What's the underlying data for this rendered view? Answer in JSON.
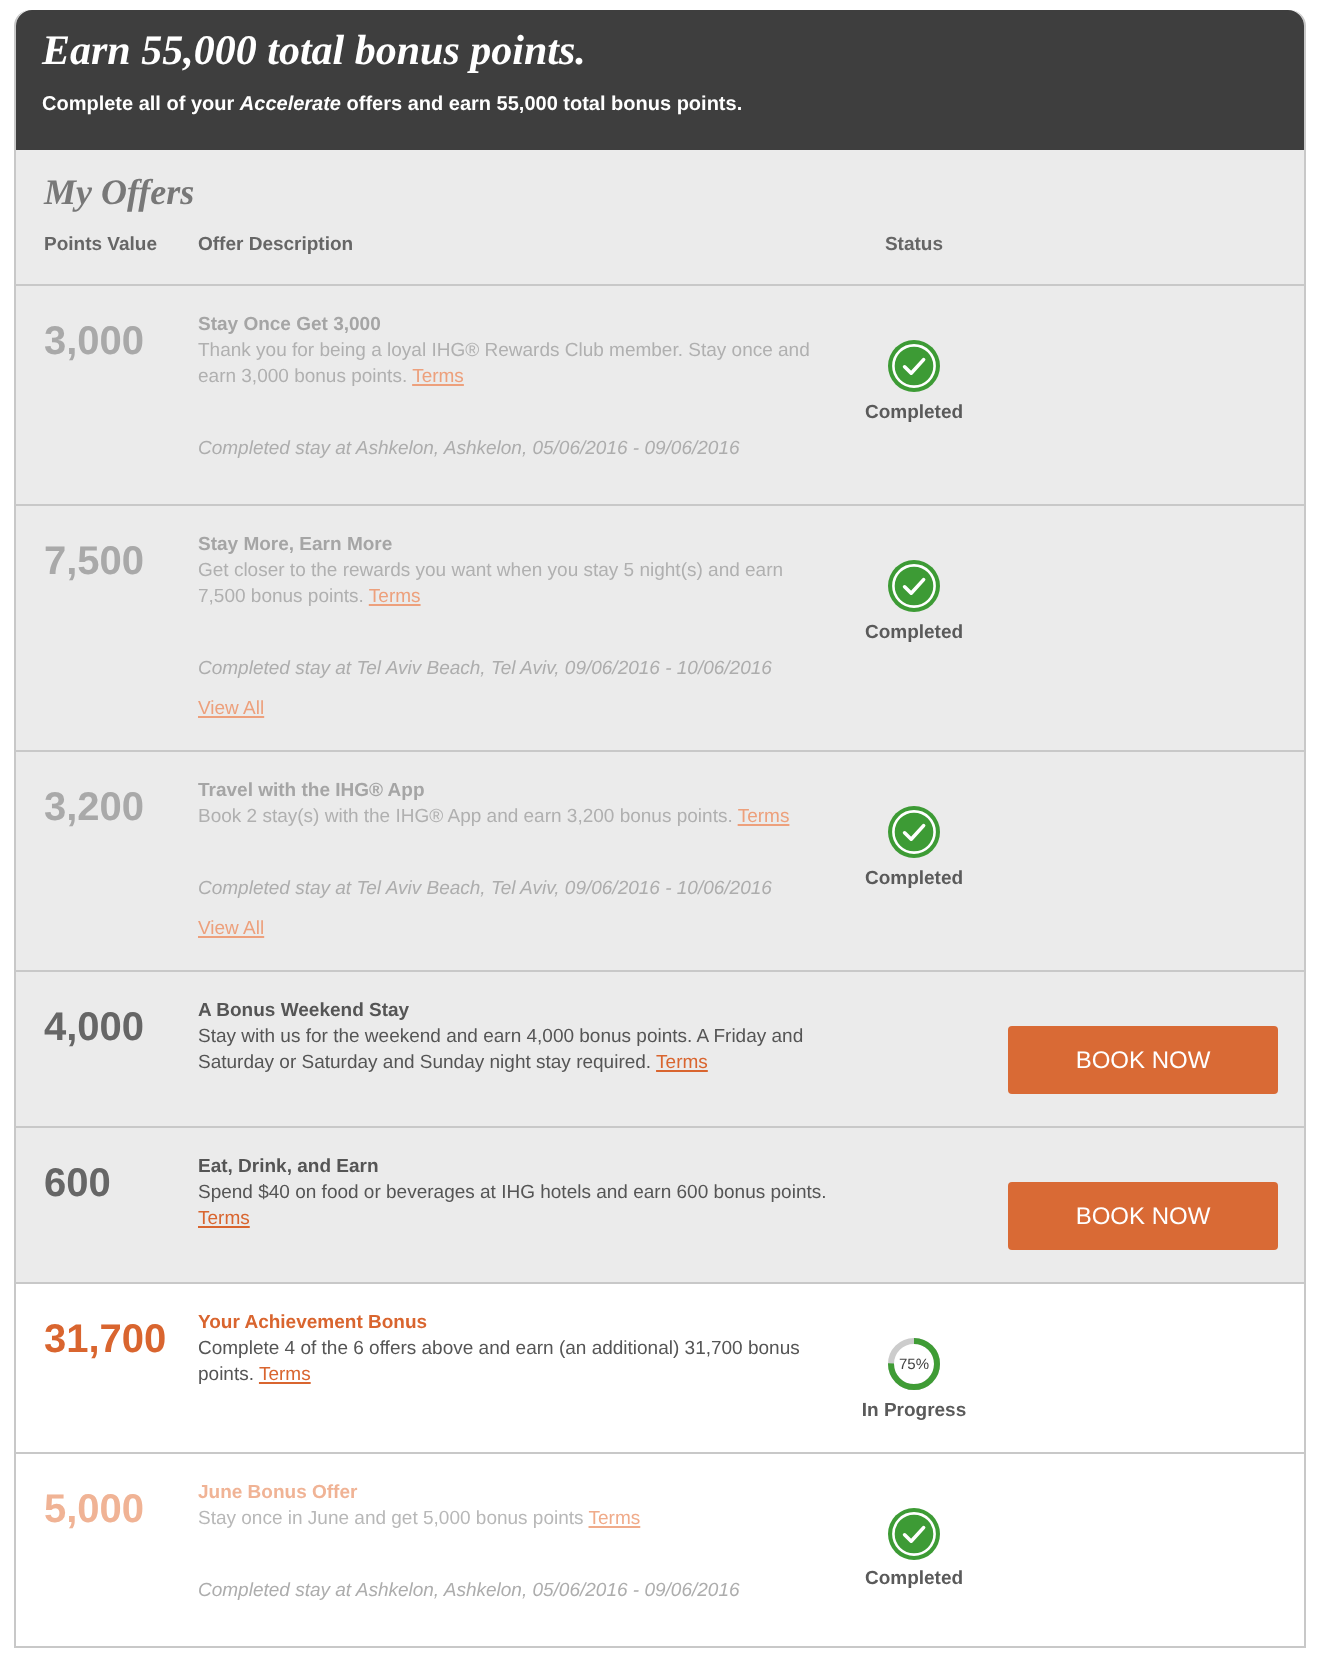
{
  "header": {
    "title": "Earn 55,000 total bonus points.",
    "subtitle": "Complete all of your *Accelerate* offers and earn 55,000 total bonus points."
  },
  "offers_panel": {
    "title": "My Offers",
    "columns": [
      "Points Value",
      "Offer Description",
      "Status"
    ]
  },
  "offers": [
    {
      "kind": "standard",
      "points": "3,000",
      "title": "Stay Once Get 3,000",
      "description": "Thank you for being a loyal IHG® Rewards Club member. Stay once and earn 3,000 bonus points.",
      "link": "Terms",
      "stay": "Completed stay at Ashkelon, Ashkelon, 05/06/2016 - 09/06/2016",
      "status": {
        "kind": "completed",
        "label": "Completed"
      }
    },
    {
      "kind": "standard",
      "points": "7,500",
      "title": "Stay More, Earn More",
      "description": "Get closer to the rewards you want when you stay 5 night(s) and earn 7,500 bonus points.",
      "link": "Terms",
      "stay": "Completed stay at Tel Aviv Beach, Tel Aviv, 09/06/2016 - 10/06/2016",
      "more_link": "View All",
      "status": {
        "kind": "completed",
        "label": "Completed"
      }
    },
    {
      "kind": "standard",
      "points": "3,200",
      "title": "Travel with the IHG® App",
      "description": "Book 2 stay(s) with the IHG® App and earn 3,200 bonus points.",
      "link": "Terms",
      "stay": "Completed stay at Tel Aviv Beach, Tel Aviv, 09/06/2016 - 10/06/2016",
      "more_link": "View All",
      "status": {
        "kind": "completed",
        "label": "Completed"
      }
    },
    {
      "kind": "standard",
      "points": "4,000",
      "title": "A Bonus Weekend Stay",
      "description": "Stay with us for the weekend and earn 4,000 bonus points. A Friday and Saturday or Saturday and Sunday night stay required.",
      "link": "Terms",
      "status": {
        "kind": "button",
        "label": "BOOK NOW"
      }
    },
    {
      "kind": "standard",
      "points": "600",
      "title": "Eat, Drink, and Earn",
      "description": "Spend $40 on food or beverages at IHG hotels and earn 600 bonus points.",
      "link": "Terms",
      "status": {
        "kind": "button",
        "label": "BOOK NOW"
      }
    },
    {
      "kind": "bonus",
      "points": "31,700",
      "title": "Your Achievement Bonus",
      "description": "Complete 4 of the 6 offers above and earn (an additional) 31,700 bonus points.",
      "link": "Terms",
      "status": {
        "kind": "progress",
        "level": 0.75,
        "reading": "75%",
        "label": "In Progress"
      }
    },
    {
      "kind": "bonus",
      "points": "5,000",
      "title": "June Bonus Offer",
      "description": "Stay once in June and get 5,000 bonus points",
      "link": "Terms",
      "stay": "Completed stay at Ashkelon, Ashkelon, 05/06/2016 - 09/06/2016",
      "status": {
        "kind": "completed",
        "label": "Completed"
      }
    }
  ]
}
